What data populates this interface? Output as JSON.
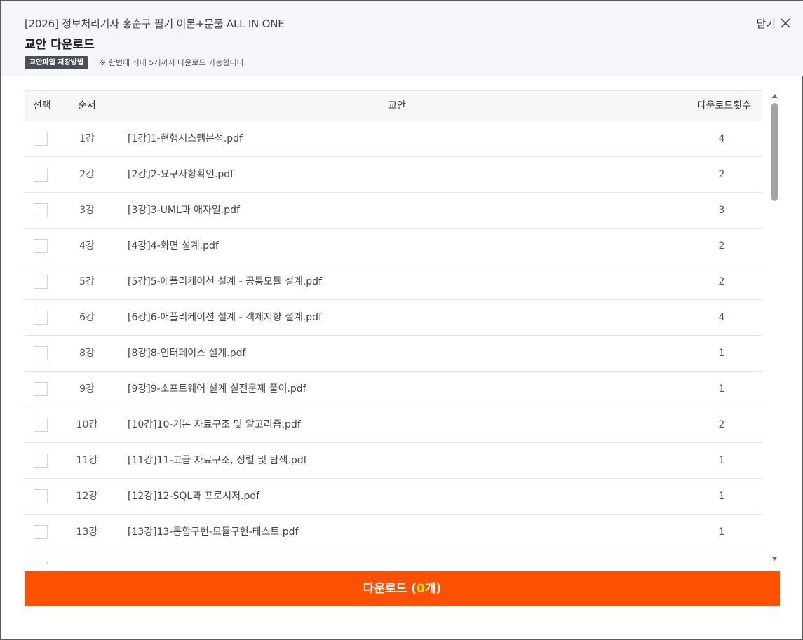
{
  "header": {
    "course_title": "[2026] 정보처리기사 홍순구 필기 이론+문풀 ALL IN ONE",
    "modal_title": "교안 다운로드",
    "save_guide_label": "교안파일 저장방법",
    "notice": "※ 한번에 최대 5개까지 다운로드 가능합니다.",
    "close_label": "닫기",
    "close_icon": "close-x-icon"
  },
  "table": {
    "columns": {
      "select": "선택",
      "order": "순서",
      "material": "교안",
      "count": "다운로드횟수"
    },
    "rows": [
      {
        "order": "1강",
        "material": "[1강]1-현행시스템분석.pdf",
        "count": "4"
      },
      {
        "order": "2강",
        "material": "[2강]2-요구사항확인.pdf",
        "count": "2"
      },
      {
        "order": "3강",
        "material": "[3강]3-UML과 애자일.pdf",
        "count": "3"
      },
      {
        "order": "4강",
        "material": "[4강]4-화면 설계.pdf",
        "count": "2"
      },
      {
        "order": "5강",
        "material": "[5강]5-애플리케이션 설계 - 공통모듈 설계.pdf",
        "count": "2"
      },
      {
        "order": "6강",
        "material": "[6강]6-애플리케이션 설계 - 객체지향 설계.pdf",
        "count": "4"
      },
      {
        "order": "8강",
        "material": "[8강]8-인터페이스 설계.pdf",
        "count": "1"
      },
      {
        "order": "9강",
        "material": "[9강]9-소프트웨어 설계 실전문제 풀이.pdf",
        "count": "1"
      },
      {
        "order": "10강",
        "material": "[10강]10-기본 자료구조 및 알고리즘.pdf",
        "count": "2"
      },
      {
        "order": "11강",
        "material": "[11강]11-고급 자료구조, 정렬 및 탐색.pdf",
        "count": "1"
      },
      {
        "order": "12강",
        "material": "[12강]12-SQL과 프로시저.pdf",
        "count": "1"
      },
      {
        "order": "13강",
        "material": "[13강]13-통합구현-모듈구현-테스트.pdf",
        "count": "1"
      },
      {
        "order": "",
        "material": "",
        "count": ""
      }
    ]
  },
  "footer": {
    "download_prefix": "다운로드 (",
    "selected_count": "0",
    "download_suffix": "개)"
  },
  "colors": {
    "accent": "#fd5000",
    "count_highlight": "#ffe600",
    "header_bg": "#f4f6f9"
  }
}
